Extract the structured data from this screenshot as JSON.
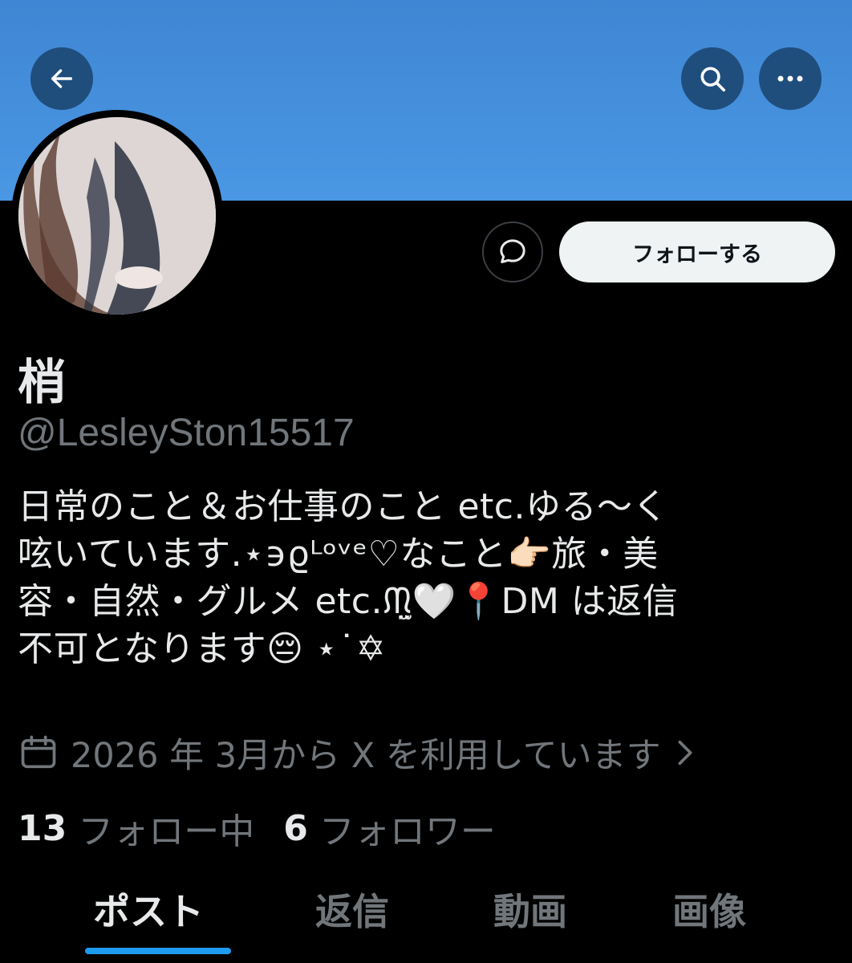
{
  "header": {
    "back_icon": "arrow-left-icon",
    "search_icon": "search-icon",
    "more_icon": "ellipsis-icon",
    "banner_color": "#4a97e4",
    "button_bg": "#1f4e7d"
  },
  "profile": {
    "display_name": "梢",
    "handle": "@LesleySton15517",
    "follow_label": "フォローする",
    "dm_icon": "message-bubble-icon",
    "bio_lines": [
      "日常のこと＆お仕事のこと etc.ゆる〜く",
      "呟いています.⋆϶ϱᴸᵒᵛᵉ♡なこと👉🏻旅・美",
      "容・自然・グルメ etc.ᙏ̤̫🤍📍DM は返信",
      "不可となります😔 ⋆˙✡"
    ],
    "joined_icon": "calendar-icon",
    "joined_text": "2026 年 3月から X を利用しています",
    "joined_chevron": "chevron-right-icon"
  },
  "stats": {
    "following_count": "13",
    "following_label": "フォロー中",
    "followers_count": "6",
    "followers_label": "フォロワー"
  },
  "tabs": [
    {
      "label": "ポスト",
      "active": true
    },
    {
      "label": "返信",
      "active": false
    },
    {
      "label": "動画",
      "active": false
    },
    {
      "label": "画像",
      "active": false
    }
  ],
  "accent_color": "#1d9bf0"
}
